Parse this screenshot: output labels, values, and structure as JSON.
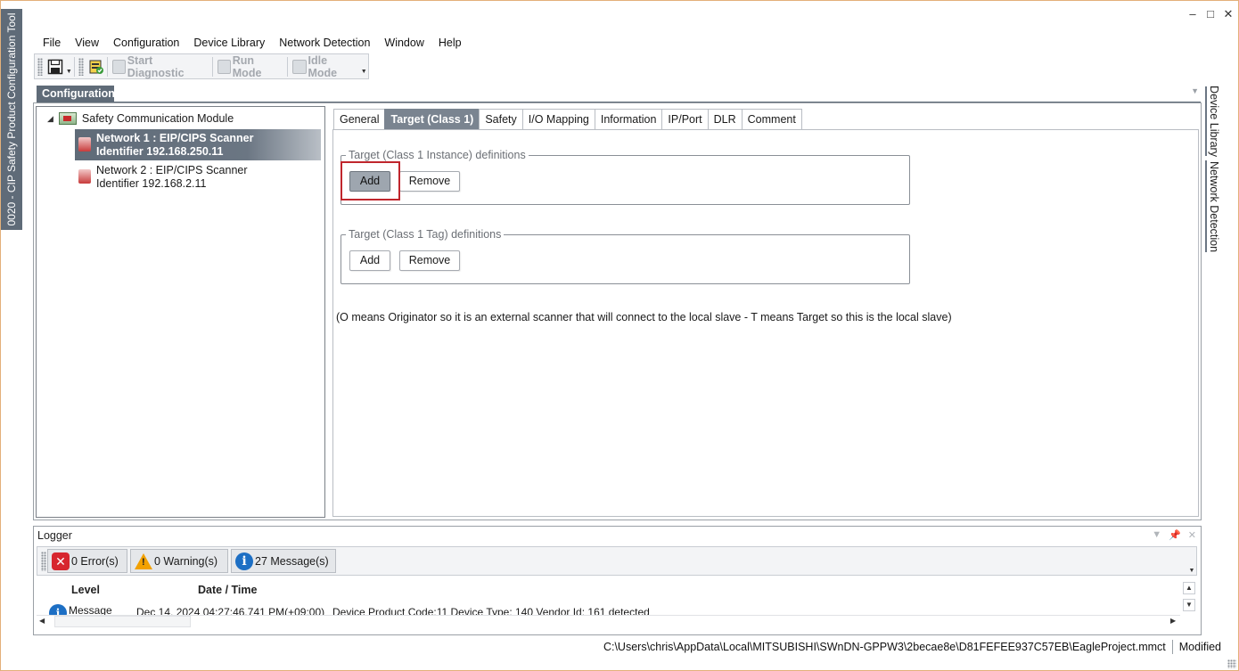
{
  "app": {
    "vertical_title": "0020 - CIP Safety Product Configuration Tool"
  },
  "window_controls": {
    "minimize": "‒",
    "maximize": "□",
    "close": "✕"
  },
  "menu": [
    "File",
    "View",
    "Configuration",
    "Device Library",
    "Network Detection",
    "Window",
    "Help"
  ],
  "toolbar": {
    "start_diagnostic": "Start Diagnostic",
    "run_mode": "Run Mode",
    "idle_mode": "Idle Mode"
  },
  "config_panel": {
    "title": "Configuration"
  },
  "tree": {
    "root": "Safety Communication Module",
    "nodes": [
      {
        "line1": "Network 1 : EIP/CIPS Scanner",
        "line2": "Identifier 192.168.250.11",
        "selected": true
      },
      {
        "line1": "Network 2 : EIP/CIPS Scanner",
        "line2": "Identifier 192.168.2.11",
        "selected": false
      }
    ]
  },
  "tabs": [
    "General",
    "Target (Class 1)",
    "Safety",
    "I/O Mapping",
    "Information",
    "IP/Port",
    "DLR",
    "Comment"
  ],
  "active_tab": "Target (Class 1)",
  "groups": {
    "instance": {
      "title": "Target (Class 1 Instance) definitions",
      "add": "Add",
      "remove": "Remove"
    },
    "tag": {
      "title": "Target (Class 1 Tag) definitions",
      "add": "Add",
      "remove": "Remove"
    }
  },
  "note": "(O means Originator so it is an external scanner that will connect to the local slave - T means Target so this is the local slave)",
  "side_tabs": [
    "Device Library",
    "Network Detection"
  ],
  "logger": {
    "title": "Logger",
    "errors": "0 Error(s)",
    "warnings": "0 Warning(s)",
    "messages": "27 Message(s)",
    "columns": {
      "level": "Level",
      "datetime": "Date / Time"
    },
    "row": {
      "level": "Message",
      "datetime": "Dec 14, 2024 04:27:46.741 PM(+09:00)",
      "description": "Device Product Code:11 Device Type: 140 Vendor Id: 161 detected"
    }
  },
  "status": {
    "path": "C:\\Users\\chris\\AppData\\Local\\MITSUBISHI\\SWnDN-GPPW3\\2becae8e\\D81FEFEE937C57EB\\EagleProject.mmct",
    "state": "Modified"
  },
  "colors": {
    "accent": "#5f6b78",
    "highlight_box": "#c0262d"
  }
}
